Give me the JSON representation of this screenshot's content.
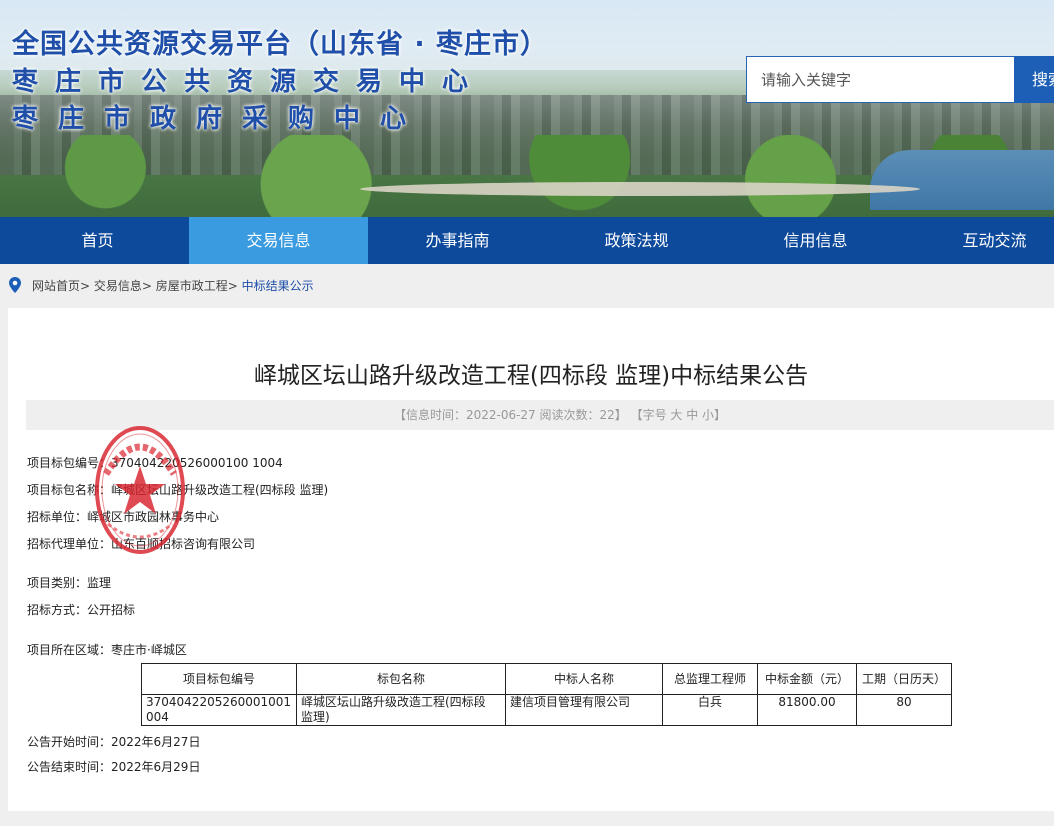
{
  "header": {
    "line1": "全国公共资源交易平台（山东省 · 枣庄市）",
    "line2": "枣庄市公共资源交易中心",
    "line3": "枣庄市政府采购中心"
  },
  "search": {
    "placeholder": "请输入关键字",
    "button_label": "搜索"
  },
  "nav": {
    "items": [
      "首页",
      "交易信息",
      "办事指南",
      "政策法规",
      "信用信息",
      "互动交流"
    ],
    "active_index": 1
  },
  "breadcrumb": {
    "items": [
      "网站首页>",
      "交易信息>",
      "房屋市政工程>",
      "中标结果公示"
    ]
  },
  "article": {
    "title": "峄城区坛山路升级改造工程(四标段 监理)中标结果公告",
    "meta": "【信息时间：2022-06-27   阅读次数：22】 【字号 大 中 小】",
    "fields": [
      "项目标包编号：370404220526000100 1004",
      "项目标包名称：峄城区坛山路升级改造工程(四标段 监理)",
      "招标单位：峄城区市政园林事务中心",
      "招标代理单位：山东百顺招标咨询有限公司",
      "项目类别：监理",
      "招标方式：公开招标",
      "项目所在区域：枣庄市·峄城区"
    ],
    "table": {
      "headers": [
        "项目标包编号",
        "标包名称",
        "中标人名称",
        "总监理工程师",
        "中标金额（元）",
        "工期（日历天）"
      ],
      "rows": [
        [
          "3704042205260001001004",
          "峄城区坛山路升级改造工程(四标段 监理)",
          "建信项目管理有限公司",
          "白兵",
          "81800.00",
          "80"
        ]
      ]
    },
    "start_time": "公告开始时间：2022年6月27日",
    "end_time": "公告结束时间：2022年6月29日"
  },
  "colors": {
    "nav_bg": "#0d4a9c",
    "nav_active": "#3a9be0",
    "title_blue": "#1f4fa8",
    "seal_red": "#d9232d"
  },
  "icons": {
    "location": "location-pin-icon",
    "seal": "official-seal-icon"
  }
}
